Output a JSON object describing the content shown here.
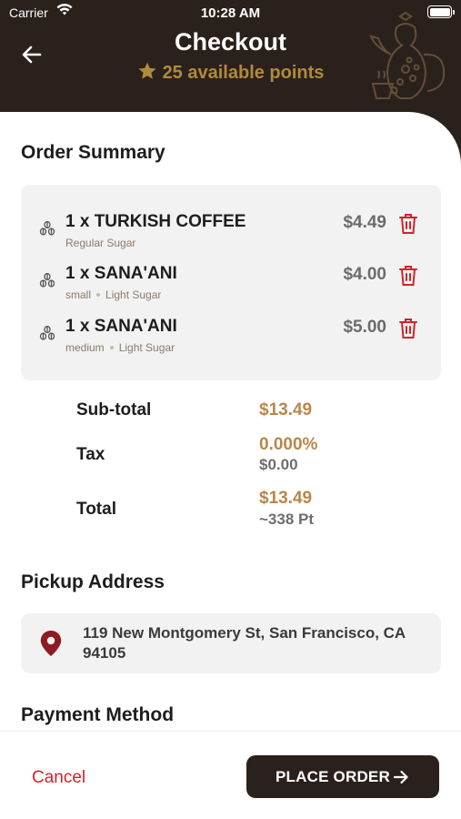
{
  "status_bar": {
    "carrier": "Carrier",
    "time": "10:28 AM"
  },
  "header": {
    "title": "Checkout",
    "points": "25 available points"
  },
  "order_summary": {
    "title": "Order Summary",
    "items": [
      {
        "name": "1 x TURKISH COFFEE",
        "options": [
          "Regular Sugar"
        ],
        "price": "$4.49"
      },
      {
        "name": "1 x SANA'ANI",
        "options": [
          "small",
          "Light Sugar"
        ],
        "price": "$4.00"
      },
      {
        "name": "1 x SANA'ANI",
        "options": [
          "medium",
          "Light Sugar"
        ],
        "price": "$5.00"
      }
    ]
  },
  "totals": {
    "subtotal_label": "Sub-total",
    "subtotal_value": "$13.49",
    "tax_label": "Tax",
    "tax_rate": "0.000%",
    "tax_value": "$0.00",
    "total_label": "Total",
    "total_value": "$13.49",
    "total_points": "~338 Pt"
  },
  "pickup": {
    "title": "Pickup Address",
    "address_line1": "119 New Montgomery St, San Francisco, CA",
    "address_line2": "94105"
  },
  "payment": {
    "title": "Payment Method"
  },
  "footer": {
    "cancel_label": "Cancel",
    "place_order_label": "PLACE ORDER"
  },
  "colors": {
    "brand_dark": "#2b211c",
    "accent_gold": "#b08a3e",
    "danger": "#d2232a"
  }
}
